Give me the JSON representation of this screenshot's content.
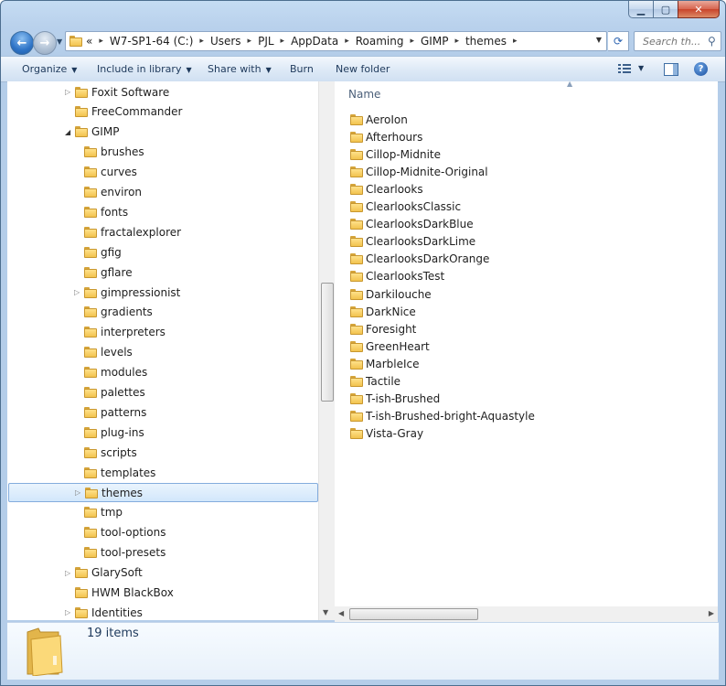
{
  "window": {
    "caption_buttons": [
      "minimize",
      "maximize",
      "close"
    ]
  },
  "address": {
    "overflow": "«",
    "crumbs": [
      "W7-SP1-64 (C:)",
      "Users",
      "PJL",
      "AppData",
      "Roaming",
      "GIMP",
      "themes"
    ]
  },
  "search": {
    "placeholder": "Search th..."
  },
  "toolbar": {
    "organize": "Organize",
    "include_in_library": "Include in library",
    "share_with": "Share with",
    "burn": "Burn",
    "new_folder": "New folder"
  },
  "nav_tree": [
    {
      "label": "Foxit Software",
      "level": 0,
      "expander": "collapsed"
    },
    {
      "label": "FreeCommander",
      "level": 0,
      "expander": "none"
    },
    {
      "label": "GIMP",
      "level": 0,
      "expander": "expanded"
    },
    {
      "label": "brushes",
      "level": 1,
      "expander": "none"
    },
    {
      "label": "curves",
      "level": 1,
      "expander": "none"
    },
    {
      "label": "environ",
      "level": 1,
      "expander": "none"
    },
    {
      "label": "fonts",
      "level": 1,
      "expander": "none"
    },
    {
      "label": "fractalexplorer",
      "level": 1,
      "expander": "none"
    },
    {
      "label": "gfig",
      "level": 1,
      "expander": "none"
    },
    {
      "label": "gflare",
      "level": 1,
      "expander": "none"
    },
    {
      "label": "gimpressionist",
      "level": 1,
      "expander": "collapsed"
    },
    {
      "label": "gradients",
      "level": 1,
      "expander": "none"
    },
    {
      "label": "interpreters",
      "level": 1,
      "expander": "none"
    },
    {
      "label": "levels",
      "level": 1,
      "expander": "none"
    },
    {
      "label": "modules",
      "level": 1,
      "expander": "none"
    },
    {
      "label": "palettes",
      "level": 1,
      "expander": "none"
    },
    {
      "label": "patterns",
      "level": 1,
      "expander": "none"
    },
    {
      "label": "plug-ins",
      "level": 1,
      "expander": "none"
    },
    {
      "label": "scripts",
      "level": 1,
      "expander": "none"
    },
    {
      "label": "templates",
      "level": 1,
      "expander": "none"
    },
    {
      "label": "themes",
      "level": 1,
      "expander": "collapsed",
      "selected": true
    },
    {
      "label": "tmp",
      "level": 1,
      "expander": "none"
    },
    {
      "label": "tool-options",
      "level": 1,
      "expander": "none"
    },
    {
      "label": "tool-presets",
      "level": 1,
      "expander": "none"
    },
    {
      "label": "GlarySoft",
      "level": 0,
      "expander": "collapsed"
    },
    {
      "label": "HWM BlackBox",
      "level": 0,
      "expander": "none"
    },
    {
      "label": "Identities",
      "level": 0,
      "expander": "collapsed"
    }
  ],
  "file_list": {
    "column_header": "Name",
    "items": [
      "AeroIon",
      "Afterhours",
      "Cillop-Midnite",
      "Cillop-Midnite-Original",
      "Clearlooks",
      "ClearlooksClassic",
      "ClearlooksDarkBlue",
      "ClearlooksDarkLime",
      "ClearlooksDarkOrange",
      "ClearlooksTest",
      "Darkilouche",
      "DarkNice",
      "Foresight",
      "GreenHeart",
      "MarbleIce",
      "Tactile",
      "T-ish-Brushed",
      "T-ish-Brushed-bright-Aquastyle",
      "Vista-Gray"
    ]
  },
  "status": {
    "item_count": "19 items"
  }
}
